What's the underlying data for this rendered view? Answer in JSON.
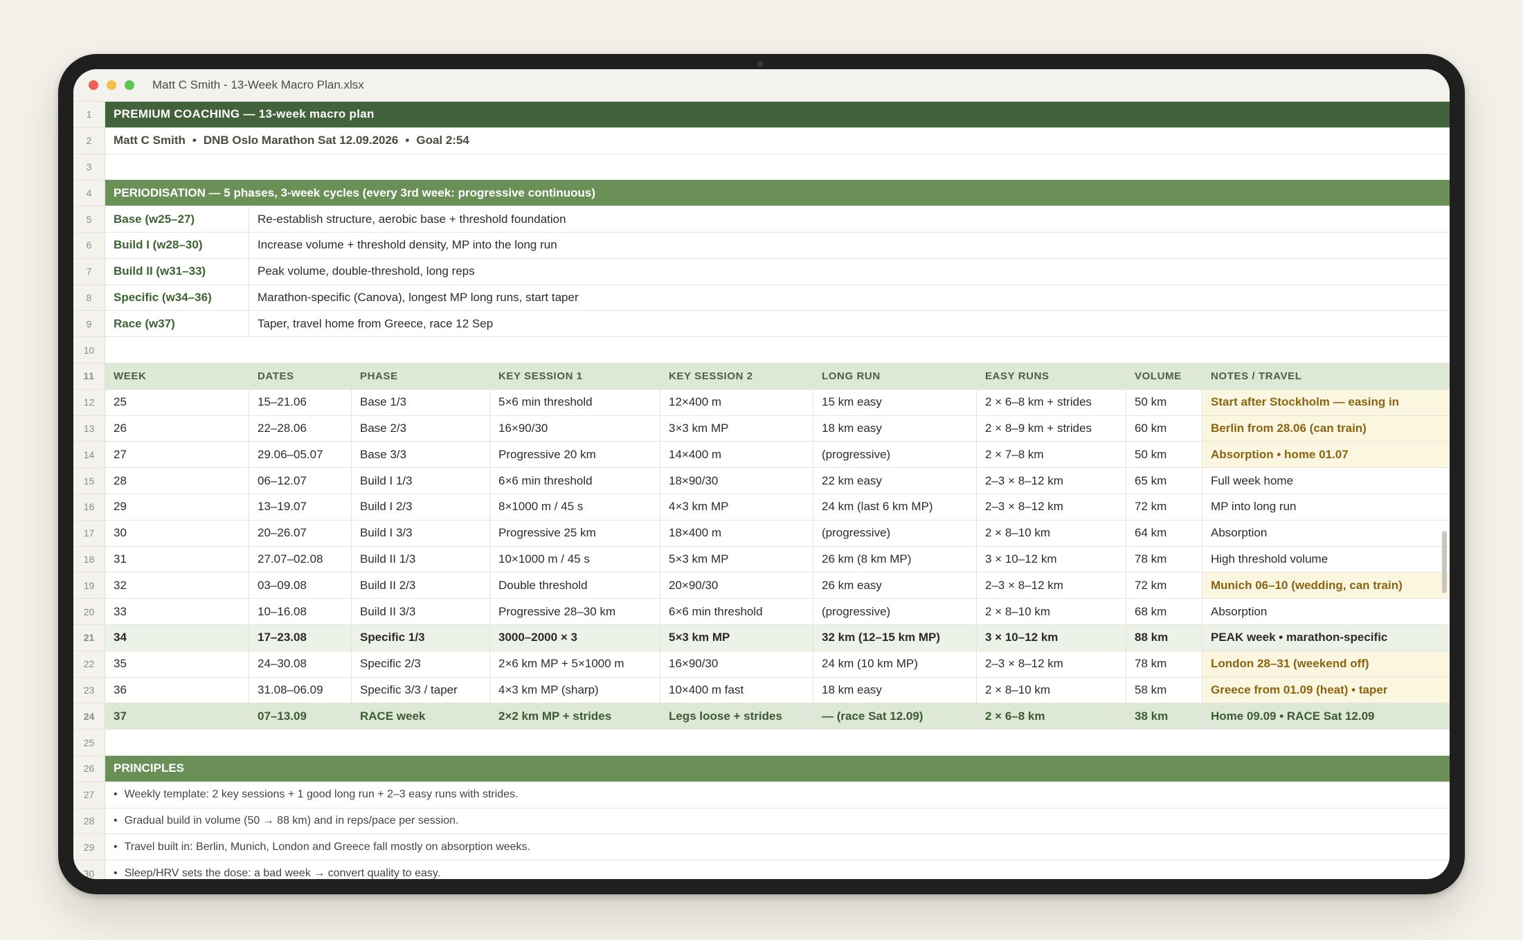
{
  "window": {
    "title": "Matt C Smith - 13-Week Macro Plan.xlsx"
  },
  "sheet": {
    "title": "PREMIUM COACHING — 13-week macro plan",
    "subtitle_parts": [
      "Matt C Smith",
      "DNB Oslo Marathon Sat 12.09.2026",
      "Goal 2:54"
    ],
    "subtitle_separator": "•",
    "periodisation_header": "PERIODISATION — 5 phases, 3-week cycles (every 3rd week: progressive continuous)",
    "phases": [
      {
        "name": "Base (w25–27)",
        "desc": "Re-establish structure, aerobic base + threshold foundation"
      },
      {
        "name": "Build I (w28–30)",
        "desc": "Increase volume + threshold density, MP into the long run"
      },
      {
        "name": "Build II (w31–33)",
        "desc": "Peak volume, double-threshold, long reps"
      },
      {
        "name": "Specific (w34–36)",
        "desc": "Marathon-specific (Canova), longest MP long runs, start taper"
      },
      {
        "name": "Race (w37)",
        "desc": "Taper, travel home from Greece, race 12 Sep"
      }
    ],
    "columns": [
      "WEEK",
      "DATES",
      "PHASE",
      "KEY SESSION 1",
      "KEY SESSION 2",
      "LONG RUN",
      "EASY RUNS",
      "VOLUME",
      "NOTES / TRAVEL"
    ],
    "weeks": [
      {
        "week": "25",
        "dates": "15–21.06",
        "phase": "Base 1/3",
        "k1": "5×6 min threshold",
        "k2": "12×400 m",
        "long": "15 km easy",
        "easy": "2 × 6–8 km + strides",
        "vol": "50 km",
        "notes": "Start after Stockholm — easing in",
        "style": "travel"
      },
      {
        "week": "26",
        "dates": "22–28.06",
        "phase": "Base 2/3",
        "k1": "16×90/30",
        "k2": "3×3 km MP",
        "long": "18 km easy",
        "easy": "2 × 8–9 km + strides",
        "vol": "60 km",
        "notes": "Berlin from 28.06 (can train)",
        "style": "travel"
      },
      {
        "week": "27",
        "dates": "29.06–05.07",
        "phase": "Base 3/3",
        "k1": "Progressive 20 km",
        "k2": "14×400 m",
        "long": "(progressive)",
        "easy": "2 × 7–8 km",
        "vol": "50 km",
        "notes": "Absorption • home 01.07",
        "style": "travel"
      },
      {
        "week": "28",
        "dates": "06–12.07",
        "phase": "Build I 1/3",
        "k1": "6×6 min threshold",
        "k2": "18×90/30",
        "long": "22 km easy",
        "easy": "2–3 × 8–12 km",
        "vol": "65 km",
        "notes": "Full week home",
        "style": "normal"
      },
      {
        "week": "29",
        "dates": "13–19.07",
        "phase": "Build I 2/3",
        "k1": "8×1000 m / 45 s",
        "k2": "4×3 km MP",
        "long": "24 km (last 6 km MP)",
        "easy": "2–3 × 8–12 km",
        "vol": "72 km",
        "notes": "MP into long run",
        "style": "normal"
      },
      {
        "week": "30",
        "dates": "20–26.07",
        "phase": "Build I 3/3",
        "k1": "Progressive 25 km",
        "k2": "18×400 m",
        "long": "(progressive)",
        "easy": "2 × 8–10 km",
        "vol": "64 km",
        "notes": "Absorption",
        "style": "normal"
      },
      {
        "week": "31",
        "dates": "27.07–02.08",
        "phase": "Build II 1/3",
        "k1": "10×1000 m / 45 s",
        "k2": "5×3 km MP",
        "long": "26 km (8 km MP)",
        "easy": "3 × 10–12 km",
        "vol": "78 km",
        "notes": "High threshold volume",
        "style": "normal"
      },
      {
        "week": "32",
        "dates": "03–09.08",
        "phase": "Build II 2/3",
        "k1": "Double threshold",
        "k2": "20×90/30",
        "long": "26 km easy",
        "easy": "2–3 × 8–12 km",
        "vol": "72 km",
        "notes": "Munich 06–10 (wedding, can train)",
        "style": "travel"
      },
      {
        "week": "33",
        "dates": "10–16.08",
        "phase": "Build II 3/3",
        "k1": "Progressive 28–30 km",
        "k2": "6×6 min threshold",
        "long": "(progressive)",
        "easy": "2 × 8–10 km",
        "vol": "68 km",
        "notes": "Absorption",
        "style": "normal"
      },
      {
        "week": "34",
        "dates": "17–23.08",
        "phase": "Specific 1/3",
        "k1": "3000–2000 × 3",
        "k2": "5×3 km MP",
        "long": "32 km (12–15 km MP)",
        "easy": "3 × 10–12 km",
        "vol": "88 km",
        "notes": "PEAK week • marathon-specific",
        "style": "peak"
      },
      {
        "week": "35",
        "dates": "24–30.08",
        "phase": "Specific 2/3",
        "k1": "2×6 km MP + 5×1000 m",
        "k2": "16×90/30",
        "long": "24 km (10 km MP)",
        "easy": "2–3 × 8–12 km",
        "vol": "78 km",
        "notes": "London 28–31 (weekend off)",
        "style": "travel"
      },
      {
        "week": "36",
        "dates": "31.08–06.09",
        "phase": "Specific 3/3 / taper",
        "k1": "4×3 km MP (sharp)",
        "k2": "10×400 m fast",
        "long": "18 km easy",
        "easy": "2 × 8–10 km",
        "vol": "58 km",
        "notes": "Greece from 01.09 (heat) • taper",
        "style": "travel"
      },
      {
        "week": "37",
        "dates": "07–13.09",
        "phase": "RACE week",
        "k1": "2×2 km MP + strides",
        "k2": "Legs loose + strides",
        "long": "— (race Sat 12.09)",
        "easy": "2 × 6–8 km",
        "vol": "38 km",
        "notes": "Home 09.09 • RACE Sat 12.09",
        "style": "race"
      }
    ],
    "principles_header": "PRINCIPLES",
    "principles": [
      "Weekly template: 2 key sessions + 1 good long run + 2–3 easy runs with strides.",
      "Gradual build in volume (50 → 88 km) and in reps/pace per session.",
      "Travel built in: Berlin, Munich, London and Greece fall mostly on absorption weeks.",
      "Sleep/HRV sets the dose: a bad week → convert quality to easy."
    ],
    "bullet_char": "•"
  }
}
